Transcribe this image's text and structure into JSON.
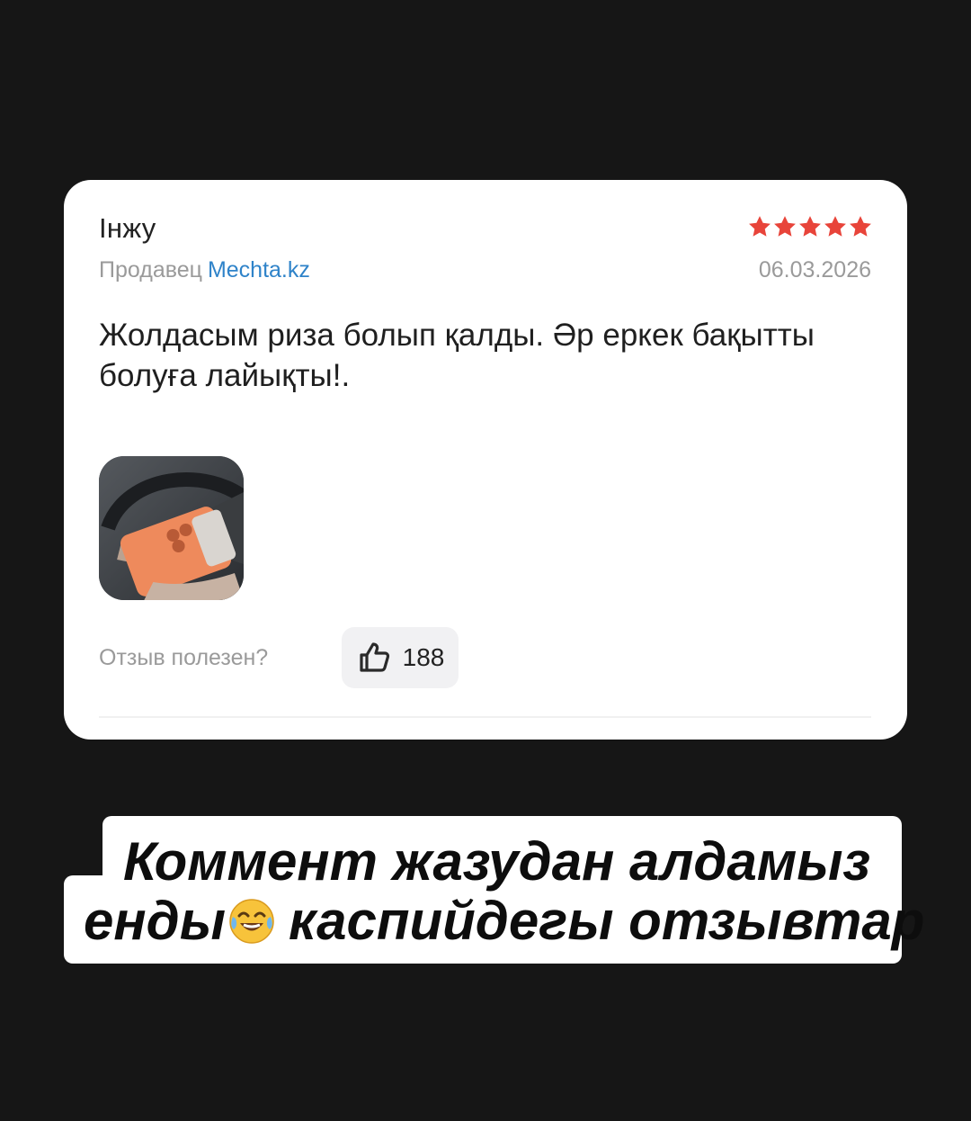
{
  "review": {
    "author": "Інжу",
    "rating": 5,
    "seller_label": "Продавец",
    "seller_name": "Mechta.kz",
    "date": "06.03.2026",
    "text": "Жолдасым риза болып қалды. Әр еркек бақытты болуға лайықты!.",
    "helpful_label": "Отзыв полезен?",
    "likes": "188",
    "star_color": "#e8443a",
    "link_color": "#2f83c9"
  },
  "caption": {
    "line1": "Коммент жазудан алдамыз",
    "line2_start": "енды",
    "line2_emoji": "face-with-tears-of-joy-emoji",
    "line2_end": "каспийдегы отзывтар"
  }
}
